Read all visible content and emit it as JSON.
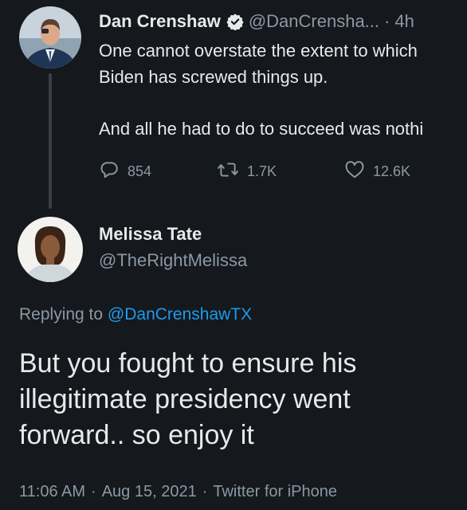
{
  "original_tweet": {
    "author_name": "Dan Crenshaw",
    "handle": "@DanCrensha...",
    "separator": "·",
    "time_ago": "4h",
    "text_lines": [
      "One cannot overstate the extent to which",
      "Biden has screwed things up.",
      "",
      "And all he had to do to succeed was nothi"
    ],
    "replies": "854",
    "retweets": "1.7K",
    "likes": "12.6K"
  },
  "reply_tweet": {
    "author_name": "Melissa Tate",
    "handle": "@TheRightMelissa",
    "replying_prefix": "Replying to",
    "replying_to": "@DanCrenshawTX",
    "text_lines": [
      "But you fought to ensure his",
      "illegitimate presidency went",
      "forward.. so enjoy it"
    ],
    "time": "11:06 AM",
    "date": "Aug 15, 2021",
    "source": "Twitter for iPhone",
    "separator": "·"
  },
  "colors": {
    "background": "#15181c",
    "text_primary": "#e7e9ea",
    "text_secondary": "#8b98a5",
    "accent": "#1d9bf0"
  },
  "icons": {
    "verified": "verified-badge-icon",
    "reply": "reply-bubble-icon",
    "retweet": "retweet-icon",
    "like": "heart-icon"
  }
}
